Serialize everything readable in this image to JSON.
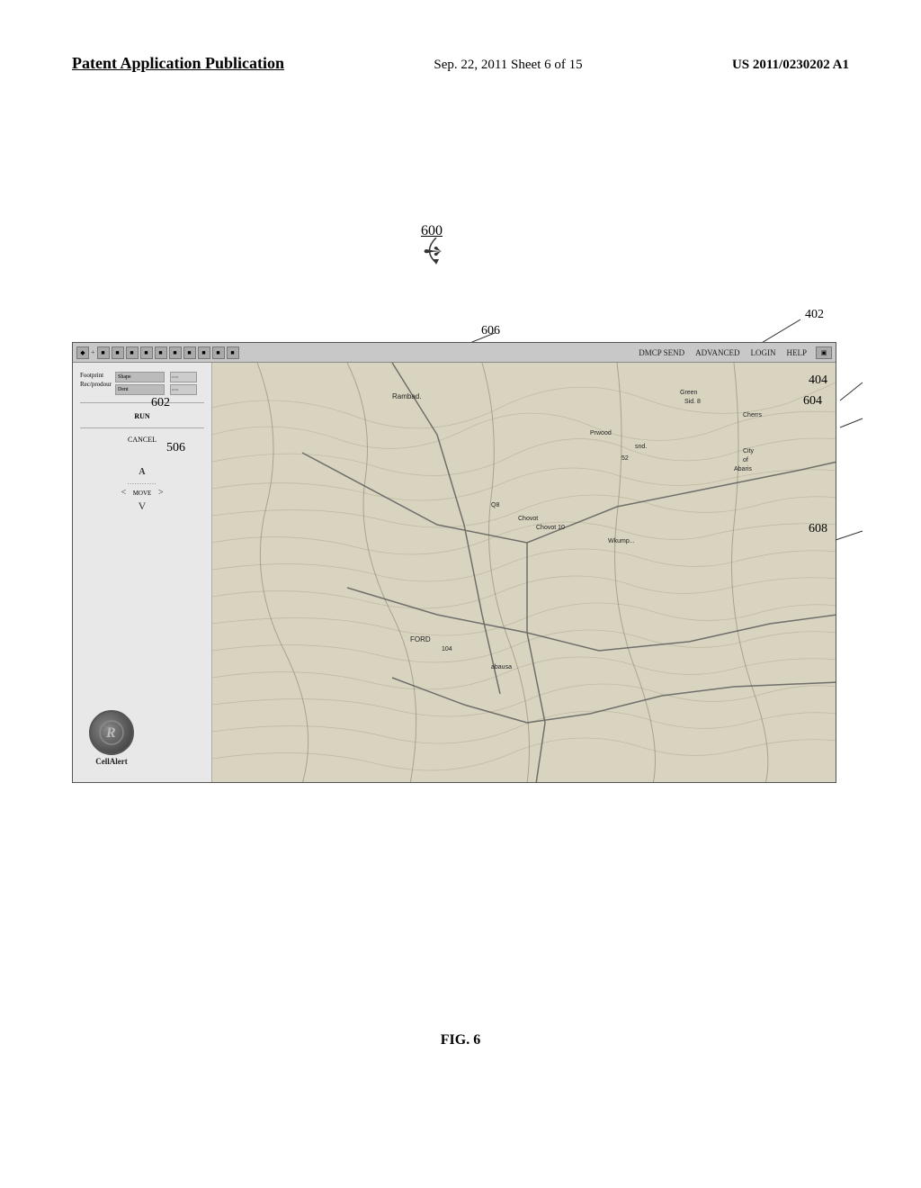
{
  "header": {
    "left": "Patent Application Publication",
    "center": "Sep. 22, 2011   Sheet 6 of 15",
    "right": "US 2011/0230202 A1"
  },
  "diagram": {
    "ref_600": "600",
    "ref_402": "402",
    "ref_404": "404",
    "ref_506": "506",
    "ref_602": "602",
    "ref_604": "604",
    "ref_606": "606",
    "ref_608": "608",
    "toolbar_menu": [
      "DMCP SEND",
      "ADVANCED",
      "LOGIN",
      "HELP"
    ],
    "nav": {
      "label_a": "A",
      "left": "<",
      "move": "MOVE",
      "right": ">",
      "down": "V"
    },
    "cellalerct_label": "CellAlert",
    "left_panel_items": [
      {
        "label": "Footprint",
        "value": "Shape"
      },
      {
        "label": "Rec/prodour",
        "value": "Dent"
      }
    ],
    "status_labels": [
      "RUN",
      "CANCEL"
    ]
  },
  "figure_caption": "FIG. 6"
}
